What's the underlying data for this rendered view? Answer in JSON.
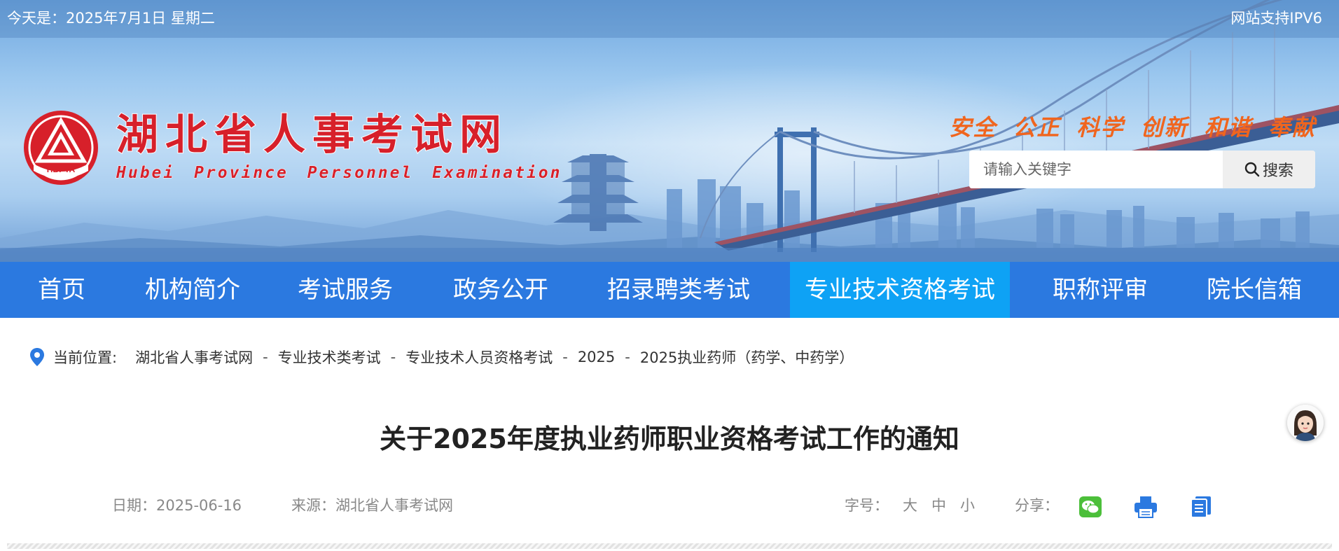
{
  "topbar": {
    "date_text": "今天是：2025年7月1日 星期二",
    "ipv6_text": "网站支持IPV6"
  },
  "brand": {
    "logo_text": "HBPTA",
    "title": "湖北省人事考试网",
    "title_en": "Hubei Province Personnel Examination",
    "slogan": [
      "安全",
      "公正",
      "科学",
      "创新",
      "和谐",
      "奉献"
    ],
    "logo_color": "#d7202a"
  },
  "search": {
    "placeholder": "请输入关键字",
    "button_label": "搜索",
    "icon": "search-icon"
  },
  "nav": {
    "items": [
      {
        "label": "首页"
      },
      {
        "label": "机构简介"
      },
      {
        "label": "考试服务"
      },
      {
        "label": "政务公开"
      },
      {
        "label": "招录聘类考试"
      },
      {
        "label": "专业技术资格考试",
        "active": true
      },
      {
        "label": "职称评审"
      },
      {
        "label": "院长信箱"
      }
    ],
    "bg_color": "#2b79e0",
    "active_color": "#0ea2f5"
  },
  "breadcrumb": {
    "label": "当前位置:",
    "items": [
      "湖北省人事考试网",
      "专业技术类考试",
      "专业技术人员资格考试",
      "2025",
      "2025执业药师（药学、中药学）"
    ],
    "separator": "-",
    "icon": "location-pin-icon"
  },
  "article": {
    "title": "关于2025年度执业药师职业资格考试工作的通知",
    "date": "日期：2025-06-16",
    "source": "来源：湖北省人事考试网",
    "font_size_label": "字号：",
    "font_sizes": [
      "大",
      "中",
      "小"
    ],
    "share_label": "分享：",
    "share_icons": [
      "wechat-icon",
      "print-icon",
      "copy-icon"
    ]
  },
  "float": {
    "icon": "assistant-avatar-icon"
  }
}
